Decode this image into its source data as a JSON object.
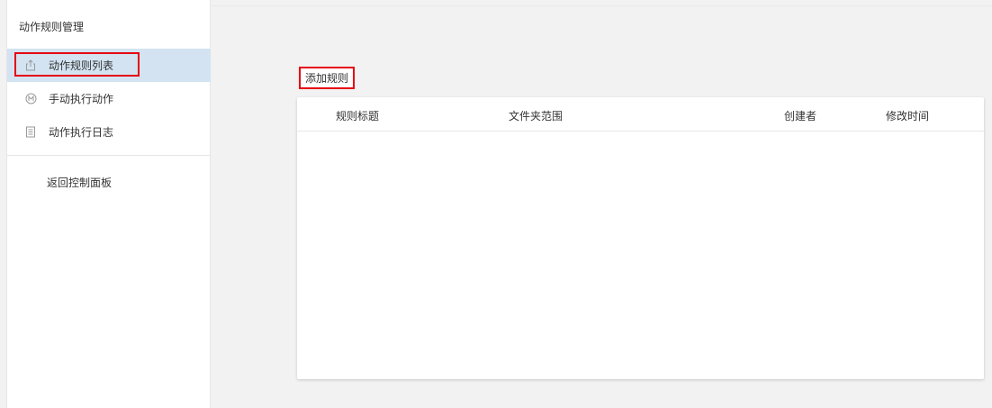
{
  "sidebar": {
    "title": "动作规则管理",
    "items": [
      {
        "label": "动作规则列表",
        "icon": "share-icon",
        "active": true
      },
      {
        "label": "手动执行动作",
        "icon": "circle-m-icon",
        "active": false
      },
      {
        "label": "动作执行日志",
        "icon": "log-icon",
        "active": false
      }
    ],
    "back_label": "返回控制面板"
  },
  "toolbar": {
    "add_rule_label": "添加规则"
  },
  "table": {
    "columns": [
      "规则标题",
      "文件夹范围",
      "创建者",
      "修改时间"
    ],
    "rows": []
  },
  "colors": {
    "highlight": "#e60012",
    "active_bg": "#d3e3f1",
    "page_bg": "#f2f2f2"
  }
}
